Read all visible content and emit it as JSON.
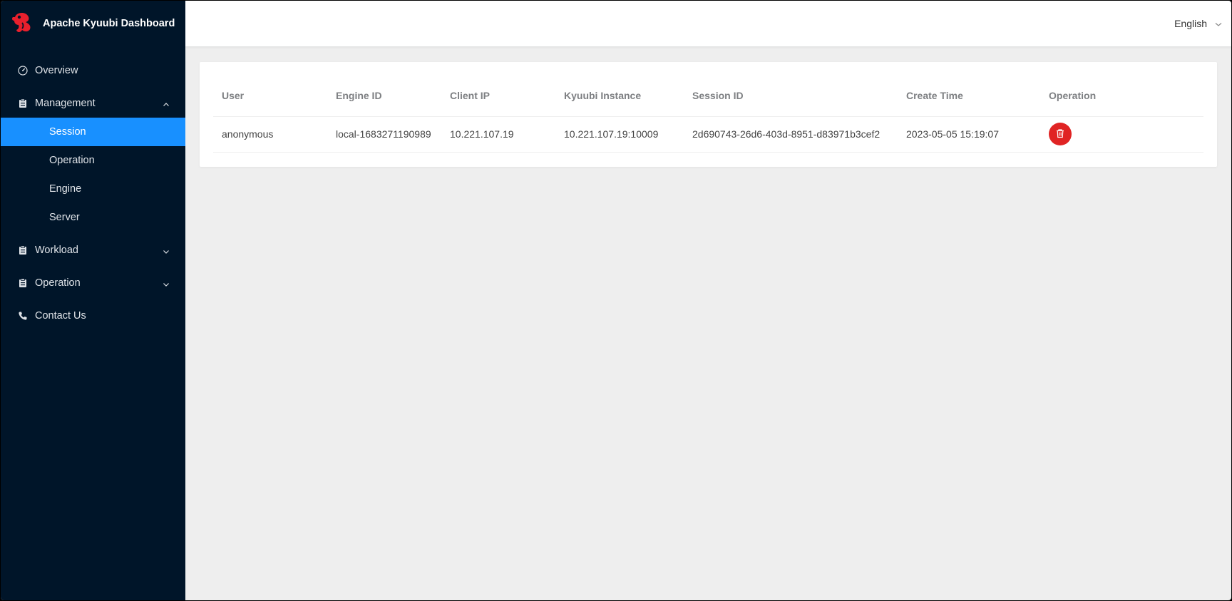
{
  "app": {
    "title": "Apache Kyuubi Dashboard",
    "logo_icon": "kyuubi-logo-icon",
    "brand_color": "#e8202d"
  },
  "header": {
    "language": "English"
  },
  "sidebar": {
    "items": [
      {
        "label": "Overview",
        "icon": "dashboard-gauge-icon"
      },
      {
        "label": "Management",
        "icon": "clipboard-icon",
        "expanded": true,
        "children": [
          {
            "label": "Session",
            "active": true
          },
          {
            "label": "Operation"
          },
          {
            "label": "Engine"
          },
          {
            "label": "Server"
          }
        ]
      },
      {
        "label": "Workload",
        "icon": "clipboard-icon",
        "expanded": false
      },
      {
        "label": "Operation",
        "icon": "clipboard-icon",
        "expanded": false
      },
      {
        "label": "Contact Us",
        "icon": "phone-icon"
      }
    ],
    "active_color": "#1890ff",
    "background": "#001529"
  },
  "table": {
    "columns": [
      "User",
      "Engine ID",
      "Client IP",
      "Kyuubi Instance",
      "Session ID",
      "Create Time",
      "Operation"
    ],
    "rows": [
      {
        "user": "anonymous",
        "engine_id": "local-1683271190989",
        "client_ip": "10.221.107.19",
        "kyuubi_instance": "10.221.107.19:10009",
        "session_id": "2d690743-26d6-403d-8951-d83971b3cef2",
        "create_time": "2023-05-05 15:19:07",
        "operation_icon": "trash-icon"
      }
    ],
    "delete_color": "#e02424"
  }
}
